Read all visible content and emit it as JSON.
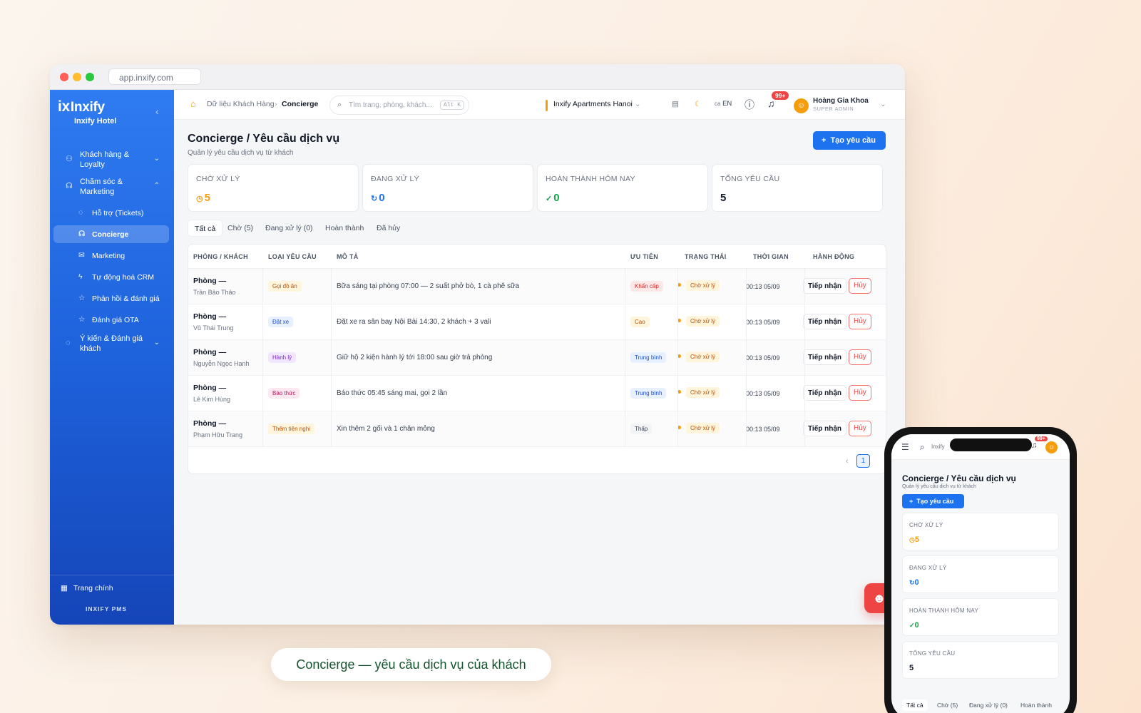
{
  "browser": {
    "url": "app.inxify.com"
  },
  "sidebar": {
    "brand": "Inxify",
    "brand_mark": "ix",
    "hotel": "Inxify Hotel",
    "groups": [
      {
        "label": "Khách hàng & Loyalty",
        "icon": "users-icon"
      },
      {
        "label": "Chăm sóc & Marketing",
        "icon": "headset-icon"
      },
      {
        "label": "Ý kiến & Đánh giá khách",
        "icon": "chat-icon"
      }
    ],
    "items": [
      {
        "label": "Hỗ trợ (Tickets)",
        "icon": "chat-bubble-icon"
      },
      {
        "label": "Concierge",
        "icon": "headset-icon"
      },
      {
        "label": "Marketing",
        "icon": "mail-icon"
      },
      {
        "label": "Tự động hoá CRM",
        "icon": "bolt-icon"
      },
      {
        "label": "Phản hồi & đánh giá",
        "icon": "star-icon"
      },
      {
        "label": "Đánh giá OTA",
        "icon": "star-icon"
      }
    ],
    "footer_home": "Trang chính",
    "footer_brand": "INXIFY PMS"
  },
  "topbar": {
    "breadcrumb_parent": "Dữ liệu Khách Hàng",
    "breadcrumb_current": "Concierge",
    "search_placeholder": "Tìm trang, phòng, khách...",
    "search_shortcut": "Alt K",
    "property": "Inxify Apartments Hanoi",
    "lang": "EN",
    "lang_prefix": "ca",
    "notif_count": "99+",
    "user_name": "Hoàng Gia Khoa",
    "user_role": "SUPER ADMIN"
  },
  "page": {
    "title": "Concierge / Yêu cầu dịch vụ",
    "subtitle": "Quản lý yêu cầu dịch vụ từ khách",
    "create_button": "Tạo yêu cầu",
    "create_icon": "+"
  },
  "stats": [
    {
      "label": "CHỜ XỬ LÝ",
      "value": "5",
      "color": "#f59e0b",
      "icon": "clock-icon"
    },
    {
      "label": "ĐANG XỬ LÝ",
      "value": "0",
      "color": "#1d72f0",
      "icon": "refresh-icon"
    },
    {
      "label": "HOÀN THÀNH HÔM NAY",
      "value": "0",
      "color": "#16a34a",
      "icon": "check-circle-icon"
    },
    {
      "label": "TỔNG YÊU CẦU",
      "value": "5",
      "color": "#111827",
      "icon": ""
    }
  ],
  "tabs": [
    "Tất cả",
    "Chờ (5)",
    "Đang xử lý (0)",
    "Hoàn thành",
    "Đã hủy"
  ],
  "table": {
    "headers": [
      "PHÒNG / KHÁCH",
      "LOẠI YÊU CẦU",
      "MÔ TẢ",
      "ƯU TIÊN",
      "TRẠNG THÁI",
      "THỜI GIAN",
      "HÀNH ĐỘNG"
    ],
    "rows": [
      {
        "room": "Phòng —",
        "guest": "Trần Bảo Thảo",
        "type": "Gọi đồ ăn",
        "desc": "Bữa sáng tại phòng 07:00 — 2 suất phở bò, 1 cà phê sữa",
        "priority": "Khẩn cấp",
        "status": "Chờ xử lý",
        "time": "00:13 05/09",
        "accept": "Tiếp nhận",
        "cancel": "Hủy"
      },
      {
        "room": "Phòng —",
        "guest": "Vũ Thái Trung",
        "type": "Đặt xe",
        "desc": "Đặt xe ra sân bay Nội Bài 14:30, 2 khách + 3 vali",
        "priority": "Cao",
        "status": "Chờ xử lý",
        "time": "00:13 05/09",
        "accept": "Tiếp nhận",
        "cancel": "Hủy"
      },
      {
        "room": "Phòng —",
        "guest": "Nguyễn Ngọc Hạnh",
        "type": "Hành lý",
        "desc": "Giữ hộ 2 kiện hành lý tới 18:00 sau giờ trả phòng",
        "priority": "Trung bình",
        "status": "Chờ xử lý",
        "time": "00:13 05/09",
        "accept": "Tiếp nhận",
        "cancel": "Hủy"
      },
      {
        "room": "Phòng —",
        "guest": "Lê Kim Hùng",
        "type": "Báo thức",
        "desc": "Báo thức 05:45 sáng mai, gọi 2 lần",
        "priority": "Trung bình",
        "status": "Chờ xử lý",
        "time": "00:13 05/09",
        "accept": "Tiếp nhận",
        "cancel": "Hủy"
      },
      {
        "room": "Phòng —",
        "guest": "Phạm Hữu Trang",
        "type": "Thêm tiện nghi",
        "desc": "Xin thêm 2 gối và 1 chăn mỏng",
        "priority": "Thấp",
        "status": "Chờ xử lý",
        "time": "00:13 05/09",
        "accept": "Tiếp nhận",
        "cancel": "Hủy"
      }
    ]
  },
  "pagination": {
    "current": "1"
  },
  "caption": "Concierge — yêu cầu dịch vụ của khách",
  "mobile": {
    "search_text": "Inxify",
    "notif_count": "99+",
    "title": "Concierge / Yêu cầu dịch vụ",
    "subtitle": "Quản lý yêu cầu dịch vụ từ khách",
    "create_button": "Tạo yêu cầu",
    "tabs": [
      "Tất cả",
      "Chờ (5)",
      "Đang xử lý (0)",
      "Hoàn thành"
    ]
  },
  "colors": {
    "accent": "#1d72f0",
    "sidebar_top": "#2f7bf1",
    "sidebar_bottom": "#1545b8",
    "danger": "#ef4444",
    "warning": "#f59e0b"
  }
}
